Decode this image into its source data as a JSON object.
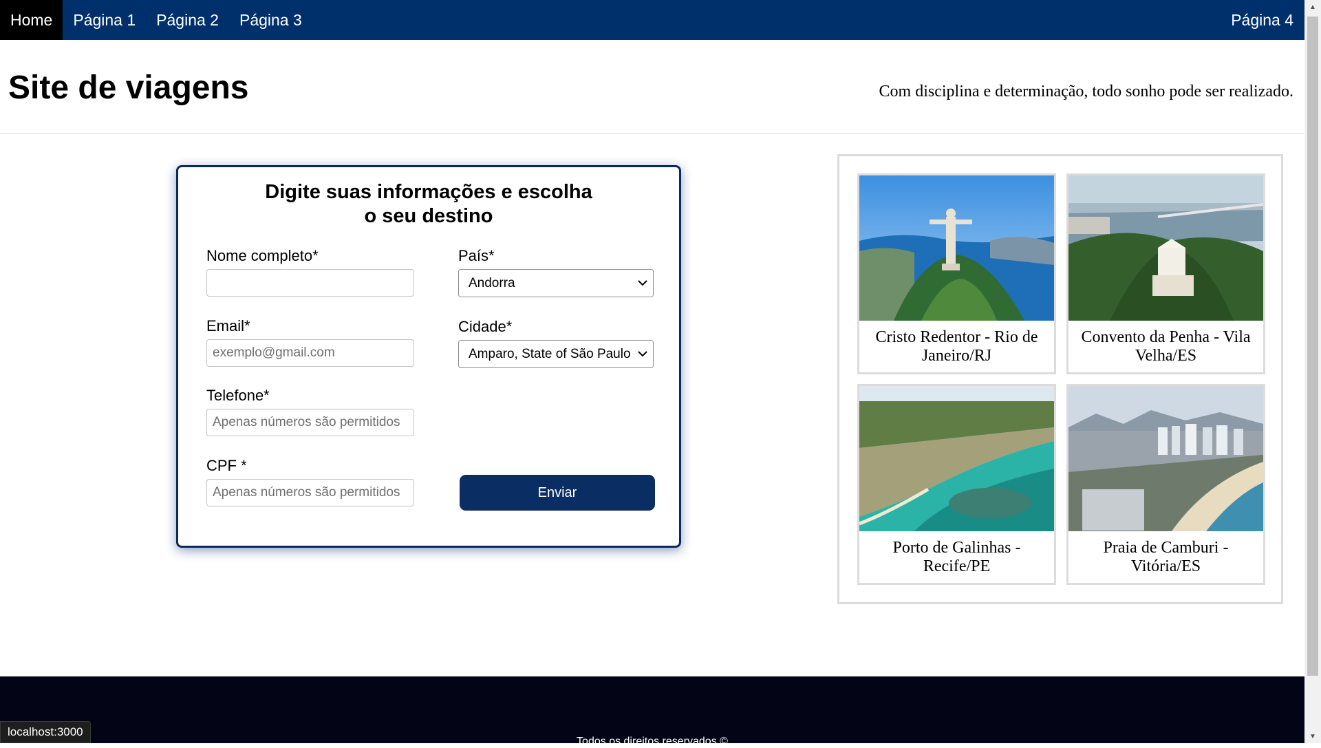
{
  "nav": {
    "items": [
      {
        "label": "Home"
      },
      {
        "label": "Página 1"
      },
      {
        "label": "Página 2"
      },
      {
        "label": "Página 3"
      }
    ],
    "right_item": "Página 4"
  },
  "header": {
    "title": "Site de viagens",
    "tagline": "Com disciplina e determinação, todo sonho pode ser realizado."
  },
  "form": {
    "title_line1": "Digite suas informações e escolha",
    "title_line2": "o seu destino",
    "name_label": "Nome completo*",
    "name_value": "",
    "email_label": "Email*",
    "email_placeholder": "exemplo@gmail.com",
    "phone_label": "Telefone*",
    "phone_placeholder": "Apenas números são permitidos",
    "cpf_label": "CPF *",
    "cpf_placeholder": "Apenas números são permitidos",
    "country_label": "País*",
    "country_value": "Andorra",
    "city_label": "Cidade*",
    "city_value": "Amparo, State of São Paulo",
    "submit_label": "Enviar"
  },
  "gallery": {
    "cards": [
      {
        "caption": "Cristo Redentor - Rio de Janeiro/RJ",
        "photo": "christ-redeemer-photo"
      },
      {
        "caption": "Convento da Penha - Vila Velha/ES",
        "photo": "convent-photo"
      },
      {
        "caption": "Porto de Galinhas - Recife/PE",
        "photo": "beach-reef-photo"
      },
      {
        "caption": "Praia de Camburi - Vitória/ES",
        "photo": "city-beach-photo"
      }
    ]
  },
  "footer": {
    "text": "Todos os direitos reservados ©"
  },
  "status": {
    "url": "localhost:3000"
  },
  "colors": {
    "navbar": "#00306b",
    "active_nav": "#000000",
    "button": "#0a2e63",
    "footer": "#030516"
  }
}
